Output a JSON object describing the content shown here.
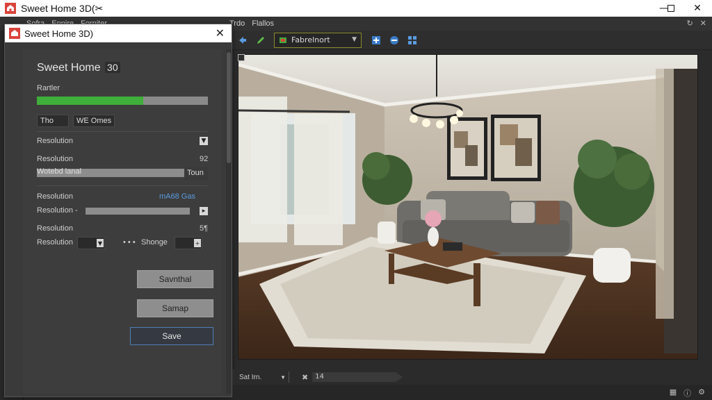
{
  "window": {
    "title": "Sweet Home 3D(✂",
    "minimize_icon": "minimize-icon",
    "maximize_icon": "maximize-icon",
    "close_icon": "close-icon"
  },
  "menubar": {
    "items": [
      "Sofra",
      "Ennire",
      "Forniter",
      "Trdo",
      "Flallos"
    ]
  },
  "toolbar": {
    "selected_label": "Fabrelnort"
  },
  "dialog": {
    "title": "Sweet Home 3D)",
    "heading": "Sweet Home",
    "heading_version": "30",
    "render_label": "Rartler",
    "progress_fraction": 0.62,
    "box1": "Tho",
    "box2": "WE Omes",
    "resolution_1": "Resolution",
    "resolution_2": "Resolution",
    "resolution_2_suffix": "92",
    "slider_label": "Wotebd lanal",
    "slider_value": "Toun",
    "resolution_3": "Resolution",
    "resolution_3_value": "mA68 Gas",
    "resolution_4": "Resolution -",
    "resolution_5": "Resolution",
    "resolution_5_suffix": "5¶",
    "resolution_6": "Resolution",
    "change_label": "Shonge",
    "dots": "• • •",
    "btn_1": "Savnthal",
    "btn_2": "Samap",
    "btn_save": "Save"
  },
  "bottombar": {
    "select_label": "Sat Irn.",
    "field_label": "14"
  },
  "colors": {
    "accent_blue": "#4f7fb8",
    "progress_green": "#3fae3a",
    "toolbar_border": "#8a8a2a"
  }
}
